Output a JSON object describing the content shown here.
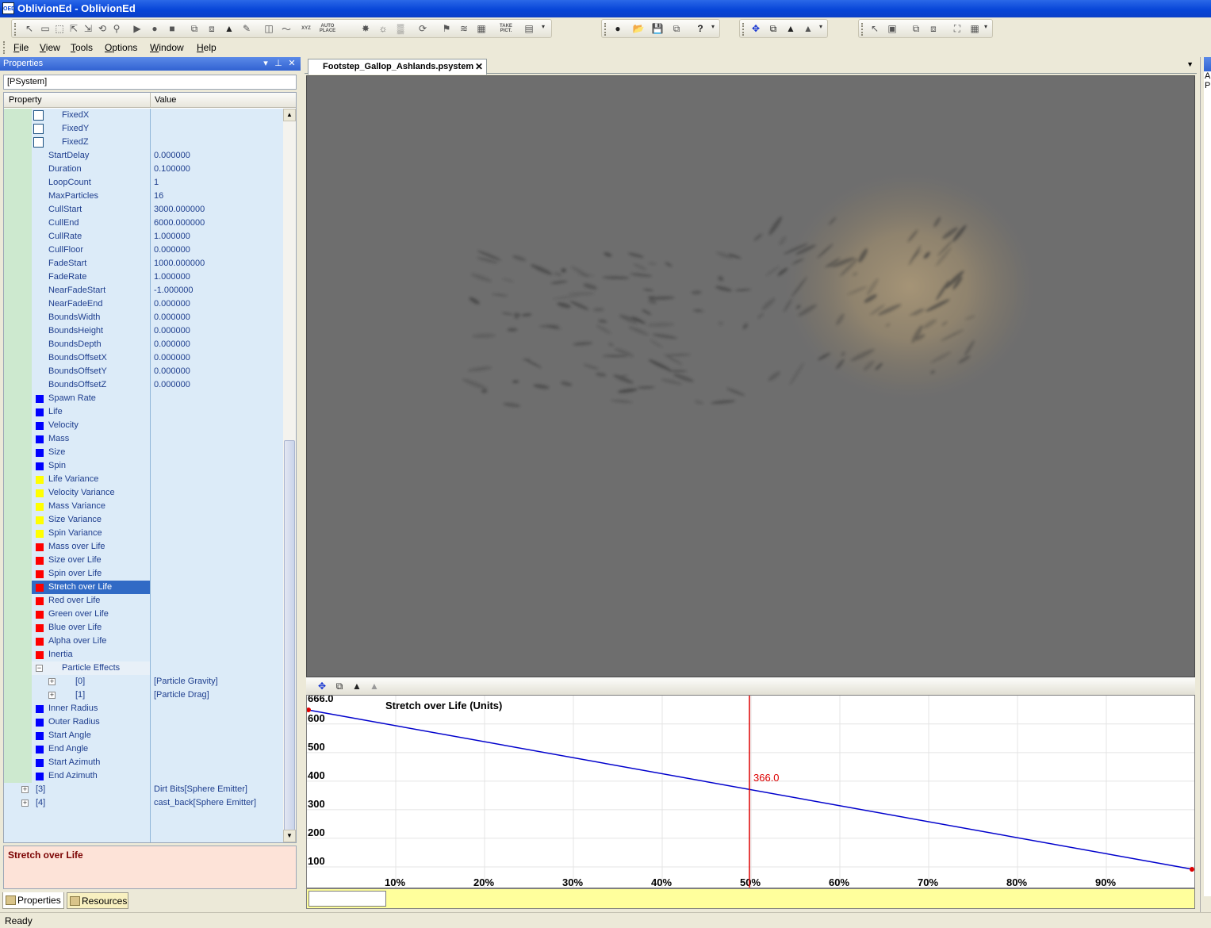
{
  "window": {
    "title": "OblivionEd - OblivionEd",
    "icon_text": "OED"
  },
  "menu": [
    "File",
    "View",
    "Tools",
    "Options",
    "Window",
    "Help"
  ],
  "toolbar": {
    "take_pict": "TAKE PICT.",
    "auto_place": "AUTO PLACE",
    "xyz": "XYZ"
  },
  "properties_panel": {
    "title": "Properties",
    "object": "[PSystem]",
    "columns": {
      "property": "Property",
      "value": "Value"
    },
    "rows": [
      {
        "name": "FixedX",
        "value": "",
        "marker": "checkbox"
      },
      {
        "name": "FixedY",
        "value": "",
        "marker": "checkbox"
      },
      {
        "name": "FixedZ",
        "value": "",
        "marker": "checkbox"
      },
      {
        "name": "StartDelay",
        "value": "0.000000",
        "marker": "none"
      },
      {
        "name": "Duration",
        "value": "0.100000",
        "marker": "none"
      },
      {
        "name": "LoopCount",
        "value": "1",
        "marker": "none"
      },
      {
        "name": "MaxParticles",
        "value": "16",
        "marker": "none"
      },
      {
        "name": "CullStart",
        "value": "3000.000000",
        "marker": "none"
      },
      {
        "name": "CullEnd",
        "value": "6000.000000",
        "marker": "none"
      },
      {
        "name": "CullRate",
        "value": "1.000000",
        "marker": "none"
      },
      {
        "name": "CullFloor",
        "value": "0.000000",
        "marker": "none"
      },
      {
        "name": "FadeStart",
        "value": "1000.000000",
        "marker": "none"
      },
      {
        "name": "FadeRate",
        "value": "1.000000",
        "marker": "none"
      },
      {
        "name": "NearFadeStart",
        "value": "-1.000000",
        "marker": "none"
      },
      {
        "name": "NearFadeEnd",
        "value": "0.000000",
        "marker": "none"
      },
      {
        "name": "BoundsWidth",
        "value": "0.000000",
        "marker": "none"
      },
      {
        "name": "BoundsHeight",
        "value": "0.000000",
        "marker": "none"
      },
      {
        "name": "BoundsDepth",
        "value": "0.000000",
        "marker": "none"
      },
      {
        "name": "BoundsOffsetX",
        "value": "0.000000",
        "marker": "none"
      },
      {
        "name": "BoundsOffsetY",
        "value": "0.000000",
        "marker": "none"
      },
      {
        "name": "BoundsOffsetZ",
        "value": "0.000000",
        "marker": "none"
      },
      {
        "name": "Spawn Rate",
        "value": "",
        "marker": "blue"
      },
      {
        "name": "Life",
        "value": "",
        "marker": "blue"
      },
      {
        "name": "Velocity",
        "value": "",
        "marker": "blue"
      },
      {
        "name": "Mass",
        "value": "",
        "marker": "blue"
      },
      {
        "name": "Size",
        "value": "",
        "marker": "blue"
      },
      {
        "name": "Spin",
        "value": "",
        "marker": "blue"
      },
      {
        "name": "Life Variance",
        "value": "",
        "marker": "yellow"
      },
      {
        "name": "Velocity Variance",
        "value": "",
        "marker": "yellow"
      },
      {
        "name": "Mass Variance",
        "value": "",
        "marker": "yellow"
      },
      {
        "name": "Size Variance",
        "value": "",
        "marker": "yellow"
      },
      {
        "name": "Spin Variance",
        "value": "",
        "marker": "yellow"
      },
      {
        "name": "Mass over Life",
        "value": "",
        "marker": "red"
      },
      {
        "name": "Size over Life",
        "value": "",
        "marker": "red"
      },
      {
        "name": "Spin over Life",
        "value": "",
        "marker": "red"
      },
      {
        "name": "Stretch over Life",
        "value": "",
        "marker": "red",
        "selected": true
      },
      {
        "name": "Red over Life",
        "value": "",
        "marker": "red"
      },
      {
        "name": "Green over Life",
        "value": "",
        "marker": "red"
      },
      {
        "name": "Blue over Life",
        "value": "",
        "marker": "red"
      },
      {
        "name": "Alpha over Life",
        "value": "",
        "marker": "red"
      },
      {
        "name": "Inertia",
        "value": "",
        "marker": "red"
      },
      {
        "name": "Particle Effects",
        "value": "",
        "marker": "group-open"
      },
      {
        "name": "[0]",
        "value": "[Particle Gravity]",
        "marker": "child-plus"
      },
      {
        "name": "[1]",
        "value": "[Particle Drag]",
        "marker": "child-plus"
      },
      {
        "name": "Inner Radius",
        "value": "",
        "marker": "blue"
      },
      {
        "name": "Outer Radius",
        "value": "",
        "marker": "blue"
      },
      {
        "name": "Start Angle",
        "value": "",
        "marker": "blue"
      },
      {
        "name": "End Angle",
        "value": "",
        "marker": "blue"
      },
      {
        "name": "Start Azimuth",
        "value": "",
        "marker": "blue"
      },
      {
        "name": "End Azimuth",
        "value": "",
        "marker": "blue"
      },
      {
        "name": "[3]",
        "value": "Dirt Bits[Sphere Emitter]",
        "marker": "root-plus"
      },
      {
        "name": "[4]",
        "value": "cast_back[Sphere Emitter]",
        "marker": "root-plus"
      }
    ],
    "description": "Stretch over Life",
    "tabs": {
      "properties": "Properties",
      "resources": "Resources"
    }
  },
  "document": {
    "tab_title": "Footstep_Gallop_Ashlands.psystem"
  },
  "curve_editor": {
    "title": "Stretch over Life (Units)",
    "y_top_label": "666.0",
    "y_ticks": [
      600,
      500,
      400,
      300,
      200,
      100
    ],
    "x_ticks": [
      "10%",
      "20%",
      "30%",
      "40%",
      "50%",
      "60%",
      "70%",
      "80%",
      "90%"
    ],
    "curve": {
      "start": 666.0,
      "end": 66.0
    },
    "y_range": [
      0,
      666
    ],
    "cursor_pos": 0.5,
    "cursor_value": "366.0",
    "colors": {
      "curve": "#0000cc",
      "cursor": "#dd0000",
      "grid": "#e4e4e4"
    }
  },
  "right_panel": {
    "letters": "A\nP"
  },
  "status": {
    "text": "Ready"
  },
  "colors": {
    "marker_blue": "#0000ff",
    "marker_yellow": "#ffff00",
    "marker_red": "#ff0000",
    "selection": "#316ac5"
  }
}
